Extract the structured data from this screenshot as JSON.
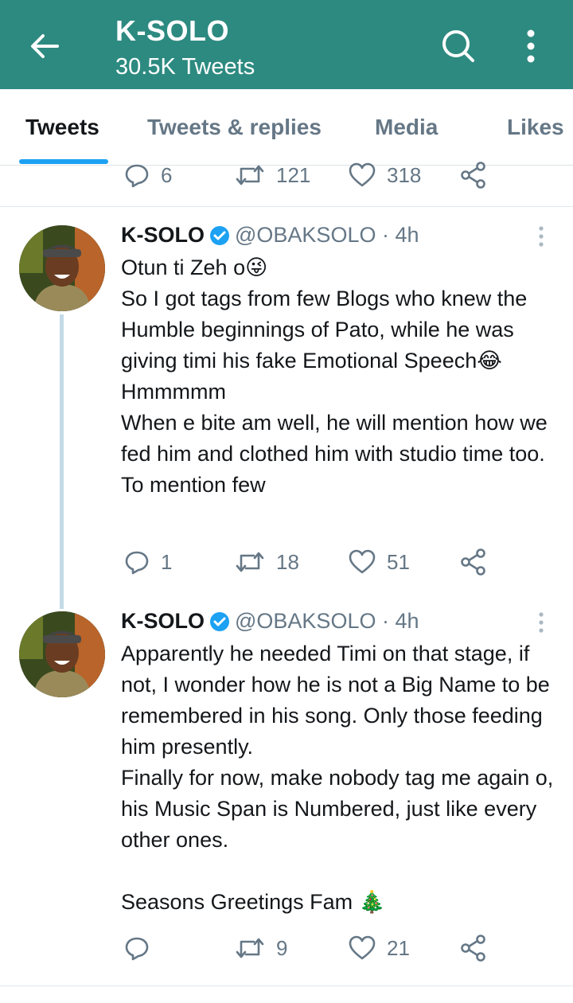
{
  "header": {
    "title": "K-SOLO",
    "subtitle": "30.5K Tweets"
  },
  "tabs": [
    {
      "label": "Tweets",
      "active": true
    },
    {
      "label": "Tweets & replies",
      "active": false
    },
    {
      "label": "Media",
      "active": false
    },
    {
      "label": "Likes",
      "active": false
    }
  ],
  "top_actions": {
    "replies": "6",
    "retweets": "121",
    "likes": "318"
  },
  "tweets": [
    {
      "name": "K-SOLO",
      "handle": "@OBAKSOLO · 4h",
      "verified": true,
      "text": "Otun ti Zeh o😜\nSo I got tags from few Blogs who knew the Humble beginnings of Pato, while he was giving timi his fake Emotional Speech😂\nHmmmmm\nWhen e bite am well, he will mention how we fed him and clothed him with studio time too. To mention few",
      "replies": "1",
      "retweets": "18",
      "likes": "51"
    },
    {
      "name": "K-SOLO",
      "handle": "@OBAKSOLO · 4h",
      "verified": true,
      "text": "Apparently he needed Timi on that stage, if not, I wonder how he is not a Big Name to be remembered in his song. Only those feeding him presently.\nFinally for now, make nobody tag me again o, his Music Span is Numbered, just like every other ones.\n\nSeasons Greetings Fam 🎄",
      "replies": "",
      "retweets": "9",
      "likes": "21"
    }
  ],
  "colors": {
    "header": "#2d8a80",
    "accent": "#1da1f2",
    "muted": "#657786",
    "verified": "#1da1f2"
  },
  "icons": [
    "back-arrow-icon",
    "search-icon",
    "more-vertical-icon",
    "reply-icon",
    "retweet-icon",
    "like-icon",
    "share-icon",
    "verified-badge-icon",
    "tweet-menu-icon"
  ]
}
